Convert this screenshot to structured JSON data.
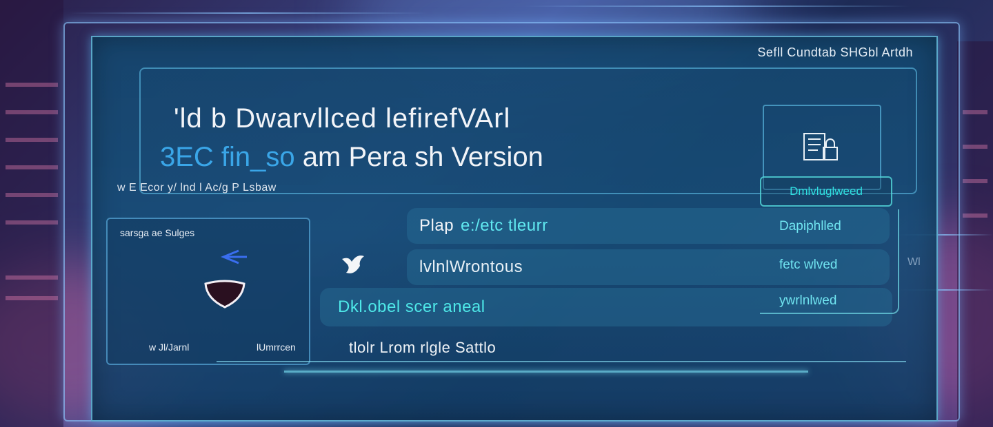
{
  "header": {
    "top_right_label": "Sefll Cundtab SHGbl Artdh",
    "title_line1": "'ld b    Dwarvllced lefirefVArl",
    "title_accent": "3EC fin_so",
    "title_main": "am Pera sh Version",
    "subline": "w E Ecor y/ lnd l Ac/g P Lsbaw",
    "status_tag": "Dmlvluglweed"
  },
  "left_card": {
    "title": "sarsga ae Sulges",
    "foot_left": "w Jl/Jarnl",
    "foot_right": "lUmrrcen"
  },
  "rows": {
    "row1_white": "Plap",
    "row1_cyan": "e:/etc tleurr",
    "row2": "lvlnlWrontous",
    "row3": "Dkl.obel scer aneal"
  },
  "right_status": {
    "s1": "Dapiphlled",
    "s2": "fetc wlved",
    "s3": "ywrlnlwed"
  },
  "footer": {
    "text": "tlolr  Lrom rlgle Sattlo"
  },
  "misc": {
    "mini_right": "Wl"
  },
  "colors": {
    "panel": "#16506f",
    "accent_cyan": "#4ee8e8",
    "accent_blue": "#3aa6e8"
  }
}
